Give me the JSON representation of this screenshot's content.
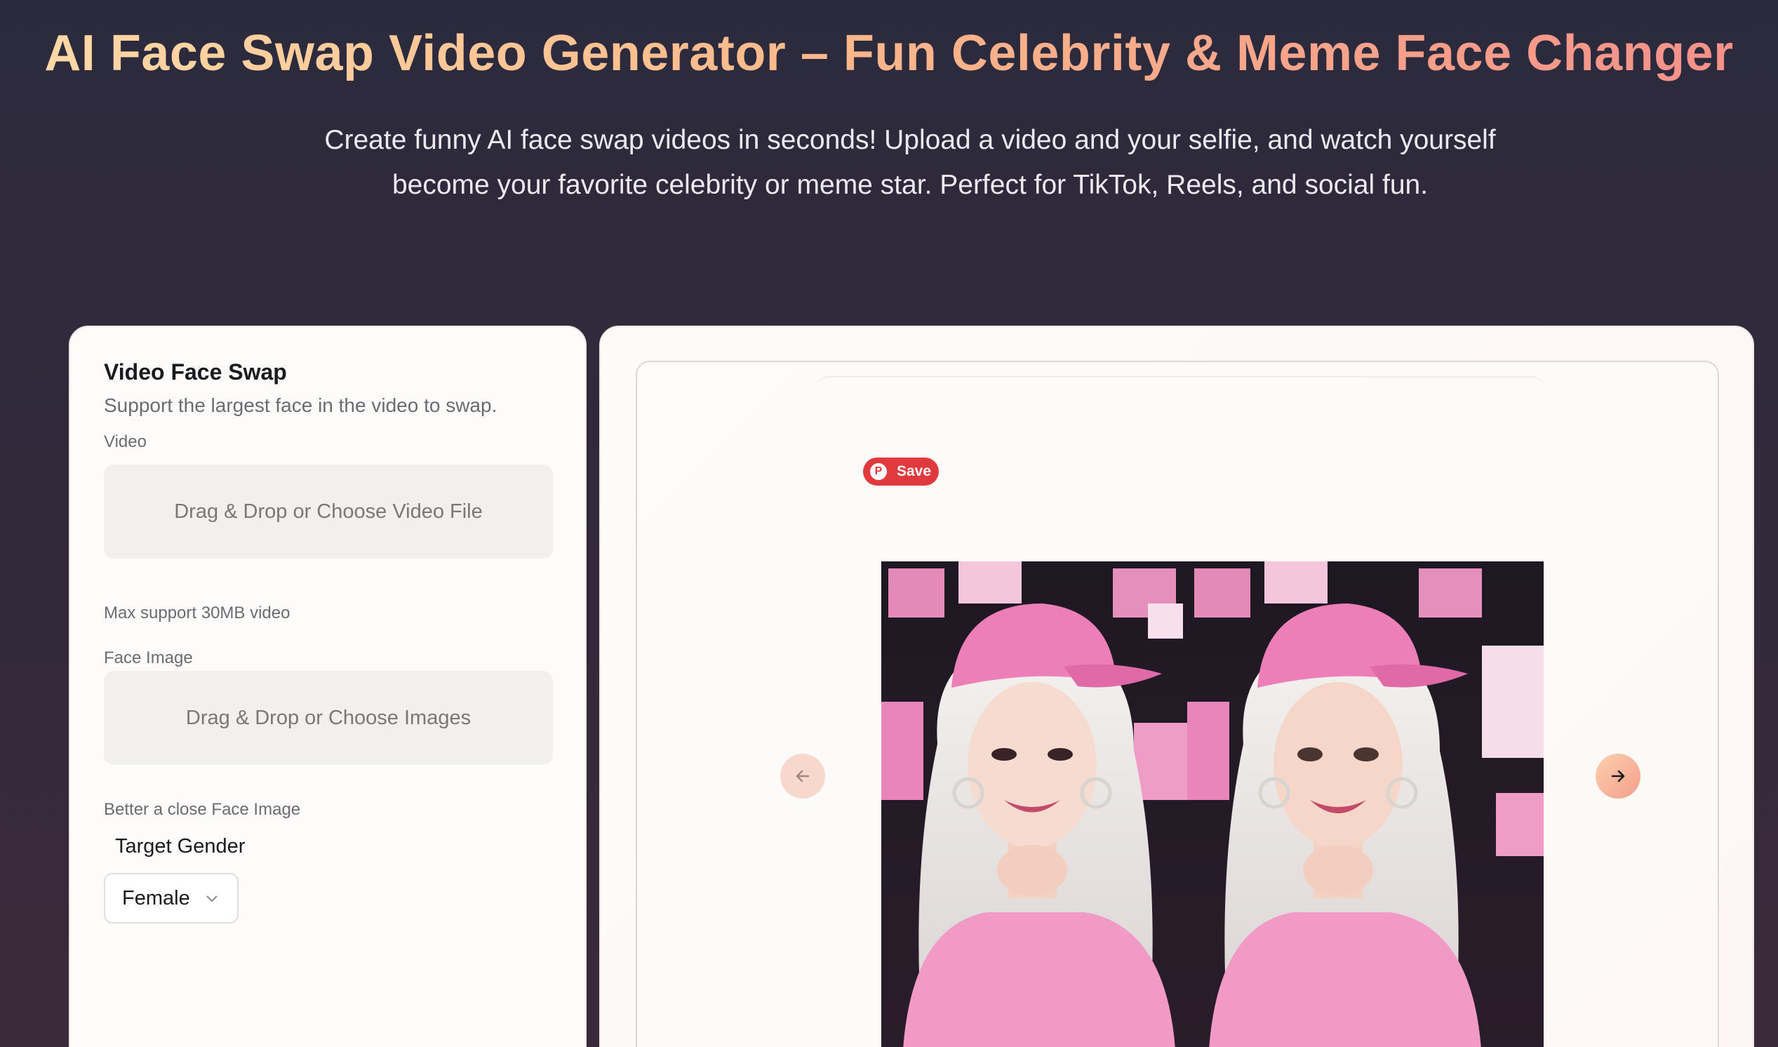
{
  "hero": {
    "title": "AI Face Swap Video Generator – Fun Celebrity & Meme Face Changer",
    "subtitle_line1": "Create funny AI face swap videos in seconds! Upload a video and your selfie, and watch yourself",
    "subtitle_line2": "become your favorite celebrity or meme star. Perfect for TikTok, Reels, and social fun."
  },
  "form": {
    "title": "Video Face Swap",
    "description": "Support the largest face in the video to swap.",
    "video_label": "Video",
    "video_drop_text": "Drag & Drop or Choose Video File",
    "video_hint": "Max support 30MB video",
    "face_label": "Face Image",
    "face_drop_text": "Drag & Drop or Choose Images",
    "face_hint": "Better a close Face Image",
    "gender_label": "Target Gender",
    "gender_value": "Female"
  },
  "preview": {
    "save_label": "Save",
    "prev_icon": "arrow-left-icon",
    "next_icon": "arrow-right-icon",
    "image_left": "original-face-image",
    "image_right": "swapped-face-image"
  },
  "colors": {
    "save_red": "#e03a3e",
    "accent_peach": "#f59f8a",
    "pink": "#e882b8"
  }
}
